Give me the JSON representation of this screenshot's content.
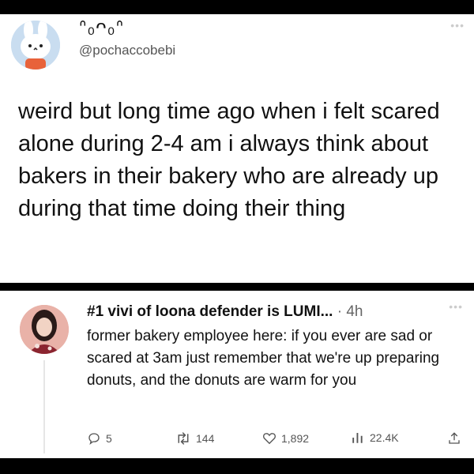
{
  "post": {
    "display_name": "ᐢ₀ᴖ₀ᐢ",
    "handle": "@pochaccobebi",
    "more_icon": "more-dots-icon",
    "text": "weird but long time ago when i felt scared alone during 2-4 am i always think about bakers in their bakery who are already up during that time doing their thing"
  },
  "reply": {
    "display_name": "#1 vivi of loona defender is LUMI...",
    "separator": " · ",
    "time": "4h",
    "text": "former bakery employee here: if you ever are sad or scared at 3am just remember that we're up preparing donuts, and the donuts are warm for you",
    "actions": {
      "replies": "5",
      "retweets": "144",
      "likes": "1,892",
      "views": "22.4K"
    }
  },
  "colors": {
    "background": "#000000",
    "panel": "#ffffff",
    "text": "#111111",
    "secondary": "#555555"
  }
}
